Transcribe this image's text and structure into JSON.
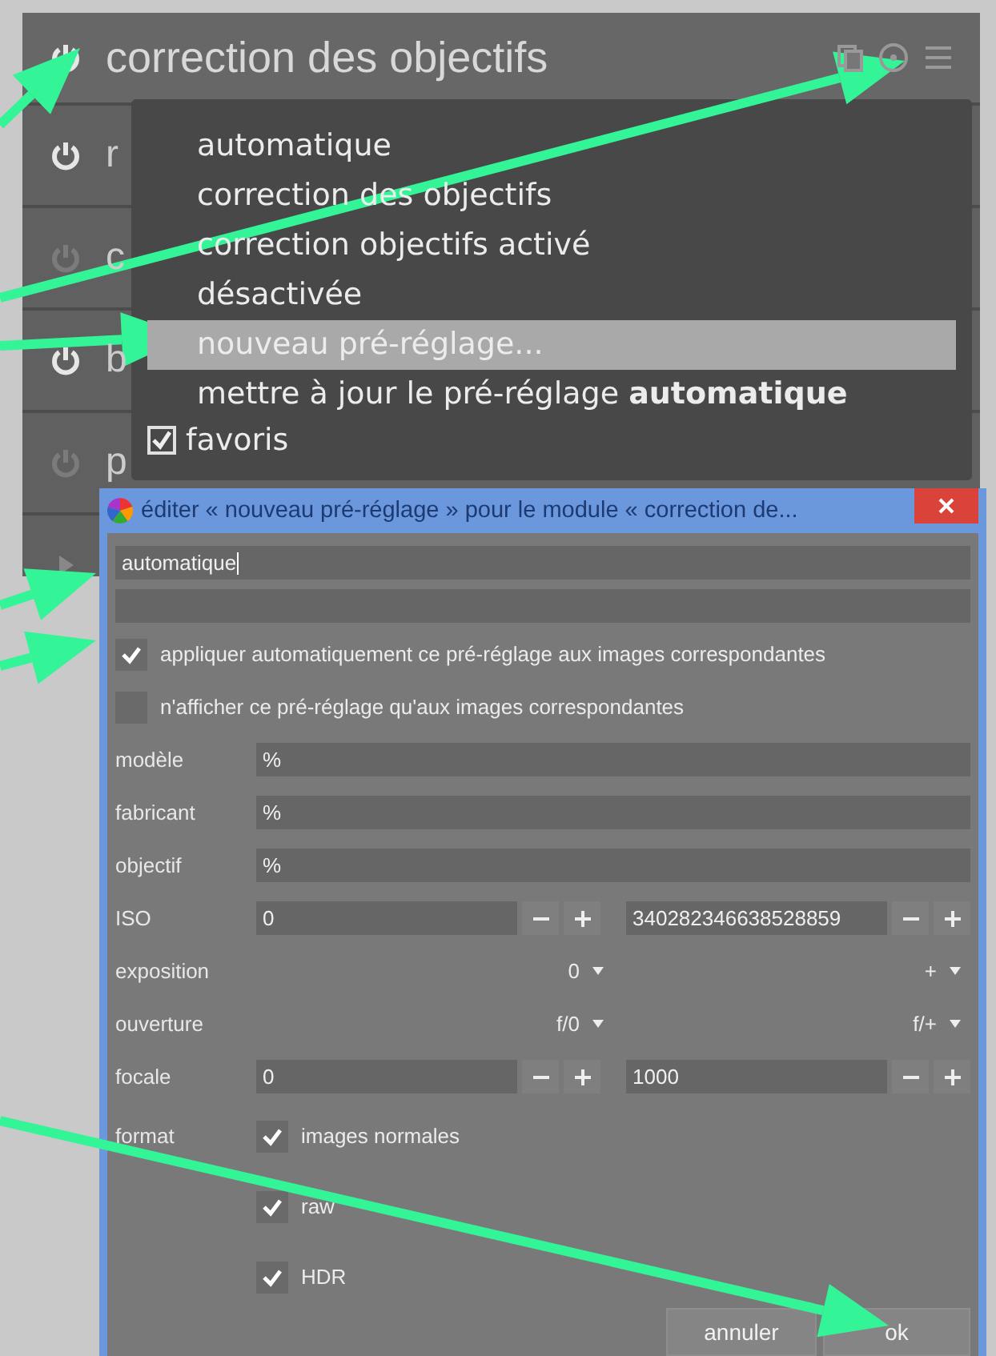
{
  "module_header": {
    "title": "correction des objectifs",
    "enabled": true
  },
  "modules": [
    {
      "label": "r",
      "enabled": true
    },
    {
      "label": "c",
      "enabled": false
    },
    {
      "label": "b",
      "enabled": true
    },
    {
      "label": "p",
      "enabled": false
    }
  ],
  "preset_menu": {
    "items": [
      {
        "label": "automatique",
        "selected": false
      },
      {
        "label": "correction des objectifs",
        "selected": false
      },
      {
        "label": "correction objectifs activé",
        "selected": false
      },
      {
        "label": "désactivée",
        "selected": false
      },
      {
        "label": "nouveau pré-réglage...",
        "selected": true
      },
      {
        "label": "mettre à jour le pré-réglage **automatique**",
        "selected": false
      }
    ],
    "favorite": {
      "label": "favoris",
      "checked": true
    }
  },
  "dialog": {
    "title": "éditer « nouveau pré-réglage » pour le module « correction de...",
    "name": {
      "value": "automatique"
    },
    "options": [
      {
        "label": "appliquer automatiquement ce pré-réglage aux images correspondantes",
        "checked": true
      },
      {
        "label": "n'afficher ce pré-réglage qu'aux images correspondantes",
        "checked": false
      }
    ],
    "rows": [
      {
        "kind": "text",
        "label": "modèle",
        "value": "%"
      },
      {
        "kind": "text",
        "label": "fabricant",
        "value": "%"
      },
      {
        "kind": "text",
        "label": "objectif",
        "value": "%"
      },
      {
        "kind": "range",
        "label": "ISO",
        "min": "0",
        "max": "340282346638528859"
      },
      {
        "kind": "select",
        "label": "exposition",
        "min": "0",
        "max": "+"
      },
      {
        "kind": "select",
        "label": "ouverture",
        "min": "f/0",
        "max": "f/+"
      },
      {
        "kind": "range",
        "label": "focale",
        "min": "0",
        "max": "1000"
      },
      {
        "kind": "checks",
        "label": "format",
        "options": [
          {
            "label": "images normales",
            "checked": true
          },
          {
            "label": "raw",
            "checked": true
          },
          {
            "label": "HDR",
            "checked": true
          }
        ]
      }
    ],
    "buttons": [
      "annuler",
      "ok"
    ]
  }
}
